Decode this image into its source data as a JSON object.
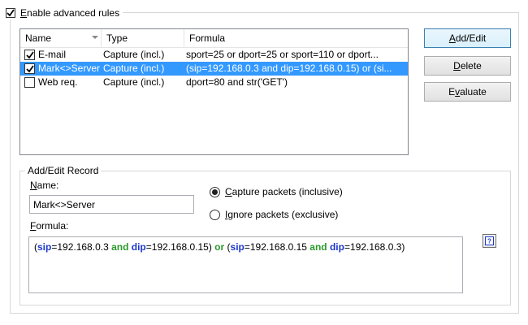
{
  "enable": {
    "label": "Enable advanced rules",
    "checked": true
  },
  "columns": {
    "name": "Name",
    "type": "Type",
    "formula": "Formula"
  },
  "rules": [
    {
      "name": "E-mail",
      "type": "Capture (incl.)",
      "formula": "sport=25 or dport=25 or sport=110 or dport...",
      "checked": true,
      "selected": false
    },
    {
      "name": "Mark<>Server",
      "type": "Capture (incl.)",
      "formula": "(sip=192.168.0.3 and dip=192.168.0.15) or (si...",
      "checked": true,
      "selected": true
    },
    {
      "name": "Web req.",
      "type": "Capture (incl.)",
      "formula": "dport=80 and str('GET')",
      "checked": false,
      "selected": false
    }
  ],
  "buttons": {
    "add_edit": "Add/Edit",
    "delete": "Delete",
    "evaluate": "Evaluate"
  },
  "record": {
    "group_title": "Add/Edit Record",
    "name_label": "Name:",
    "name_value": "Mark<>Server",
    "formula_label": "Formula:",
    "capture_label": "Capture packets (inclusive)",
    "ignore_label": "Ignore packets (exclusive)",
    "capture_selected": true,
    "formula_tokens": [
      {
        "t": "(",
        "k": "paren"
      },
      {
        "t": "sip",
        "k": "key"
      },
      {
        "t": "=192.168.0.3 ",
        "k": "val"
      },
      {
        "t": "and",
        "k": "bool"
      },
      {
        "t": " ",
        "k": "val"
      },
      {
        "t": "dip",
        "k": "key"
      },
      {
        "t": "=192.168.0.15) ",
        "k": "val"
      },
      {
        "t": "or",
        "k": "bool"
      },
      {
        "t": " (",
        "k": "paren"
      },
      {
        "t": "sip",
        "k": "key"
      },
      {
        "t": "=192.168.0.15 ",
        "k": "val"
      },
      {
        "t": "and",
        "k": "bool"
      },
      {
        "t": " ",
        "k": "val"
      },
      {
        "t": "dip",
        "k": "key"
      },
      {
        "t": "=192.168.0.3)",
        "k": "val"
      }
    ]
  },
  "colors": {
    "selection": "#3399ff",
    "keyword": "#1b38c9",
    "boolean": "#2b9a2b"
  },
  "icons": {
    "check": "checkmark-icon",
    "help": "help-icon"
  }
}
